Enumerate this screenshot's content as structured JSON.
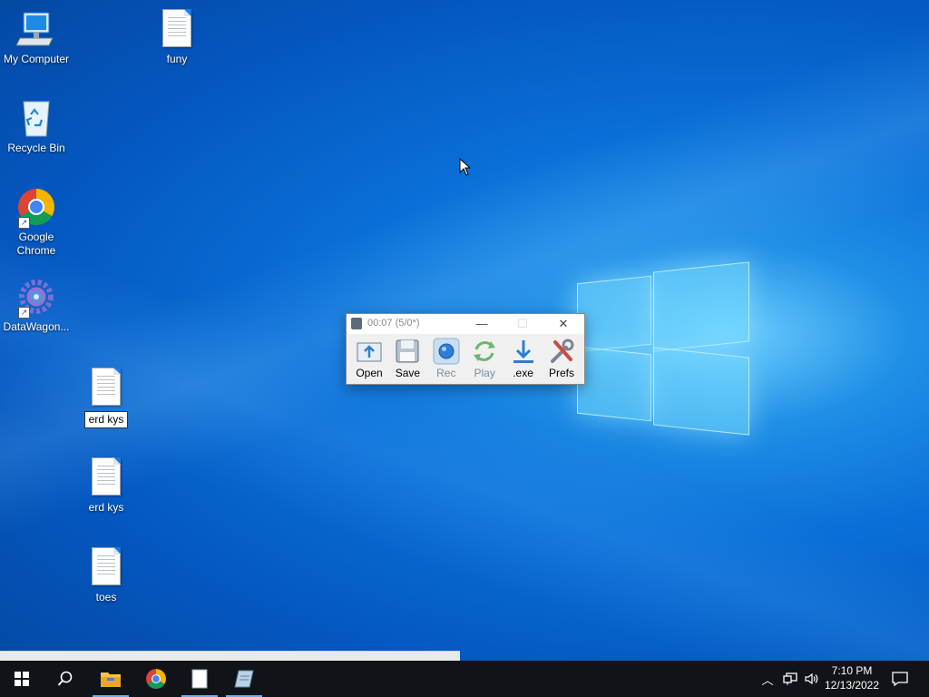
{
  "desktop": {
    "icons": {
      "my_computer": "My Computer",
      "funy": "funy",
      "recycle_bin": "Recycle Bin",
      "chrome_line1": "Google",
      "chrome_line2": "Chrome",
      "datawagon": "DataWagon...",
      "erd_rename": "erd kys",
      "erd_kys": "erd kys",
      "toes": "toes"
    }
  },
  "recorder": {
    "title": "00:07 (5/0*)",
    "tools": {
      "open": "Open",
      "save": "Save",
      "rec": "Rec",
      "play": "Play",
      "exe": ".exe",
      "prefs": "Prefs"
    }
  },
  "taskbar": {
    "clock_time": "7:10 PM",
    "clock_date": "12/13/2022"
  },
  "colors": {
    "accent": "#0a6fd8",
    "taskbar": "#101418",
    "active_underline": "#6ab0f3"
  }
}
